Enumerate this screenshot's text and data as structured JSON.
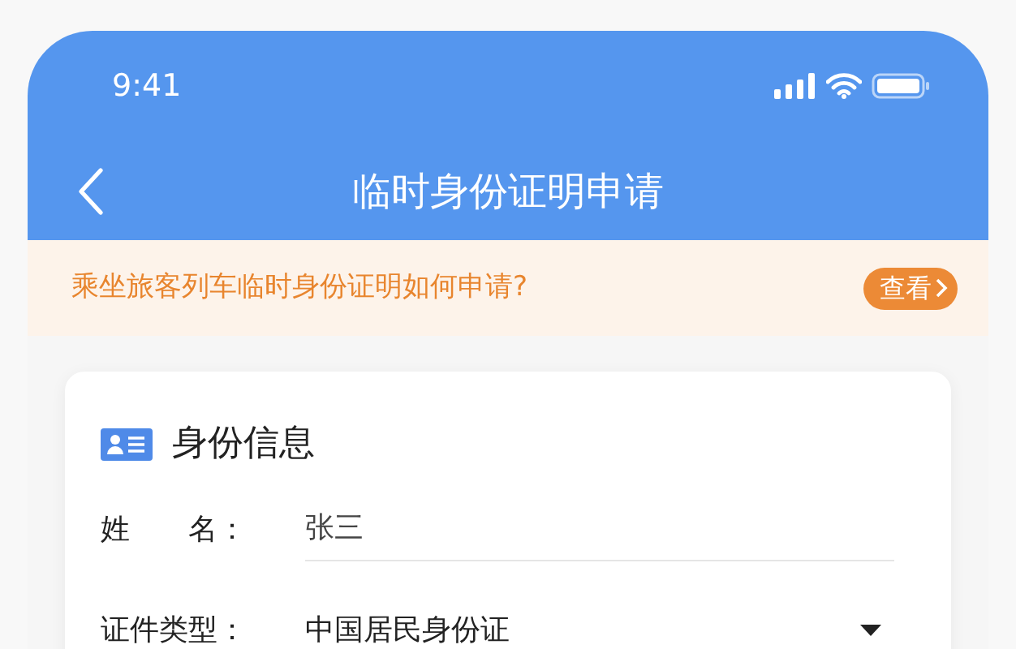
{
  "status_bar": {
    "time": "9:41"
  },
  "nav": {
    "title": "临时身份证明申请"
  },
  "notice": {
    "text": "乘坐旅客列车临时身份证明如何申请?",
    "button": "查看"
  },
  "card": {
    "title": "身份信息",
    "fields": [
      {
        "kind": "text",
        "label": "姓　　名：",
        "value": "张三"
      },
      {
        "kind": "select",
        "label": "证件类型：",
        "value": "中国居民身份证"
      }
    ]
  }
}
